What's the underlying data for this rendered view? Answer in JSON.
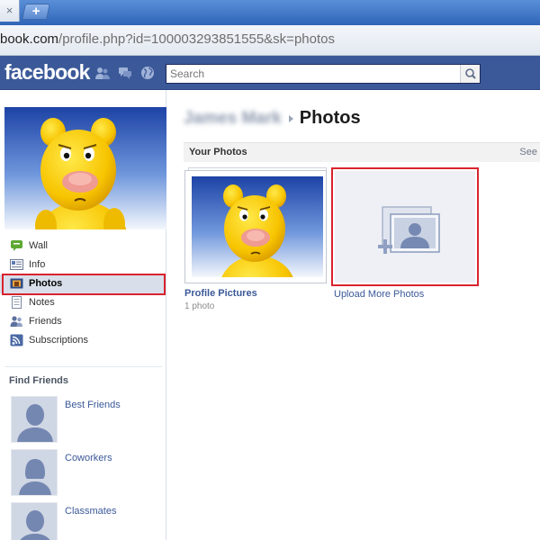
{
  "browser": {
    "tab_close_glyph": "×",
    "new_tab_glyph": "+",
    "url_host": "book.com",
    "url_rest": "/profile.php?id=100003293851555&sk=photos"
  },
  "header": {
    "logo": "facebook",
    "search_placeholder": "Search",
    "bar_color": "#3b5998"
  },
  "sidebar": {
    "nav": [
      {
        "label": "Wall",
        "icon": "wall-icon"
      },
      {
        "label": "Info",
        "icon": "info-icon"
      },
      {
        "label": "Photos",
        "icon": "photos-icon",
        "active": true
      },
      {
        "label": "Notes",
        "icon": "notes-icon"
      },
      {
        "label": "Friends",
        "icon": "friends-icon"
      },
      {
        "label": "Subscriptions",
        "icon": "subscriptions-icon"
      }
    ],
    "find_friends_title": "Find Friends",
    "find_friends": [
      {
        "label": "Best Friends"
      },
      {
        "label": "Coworkers"
      },
      {
        "label": "Classmates"
      }
    ]
  },
  "main": {
    "profile_name": "James Mark",
    "page_title": "Photos",
    "section_title": "Your Photos",
    "see_link": "See",
    "albums": [
      {
        "title": "Profile Pictures",
        "count": "1 photo"
      }
    ],
    "upload_label": "Upload More Photos"
  },
  "highlight_color": "#d9232e"
}
